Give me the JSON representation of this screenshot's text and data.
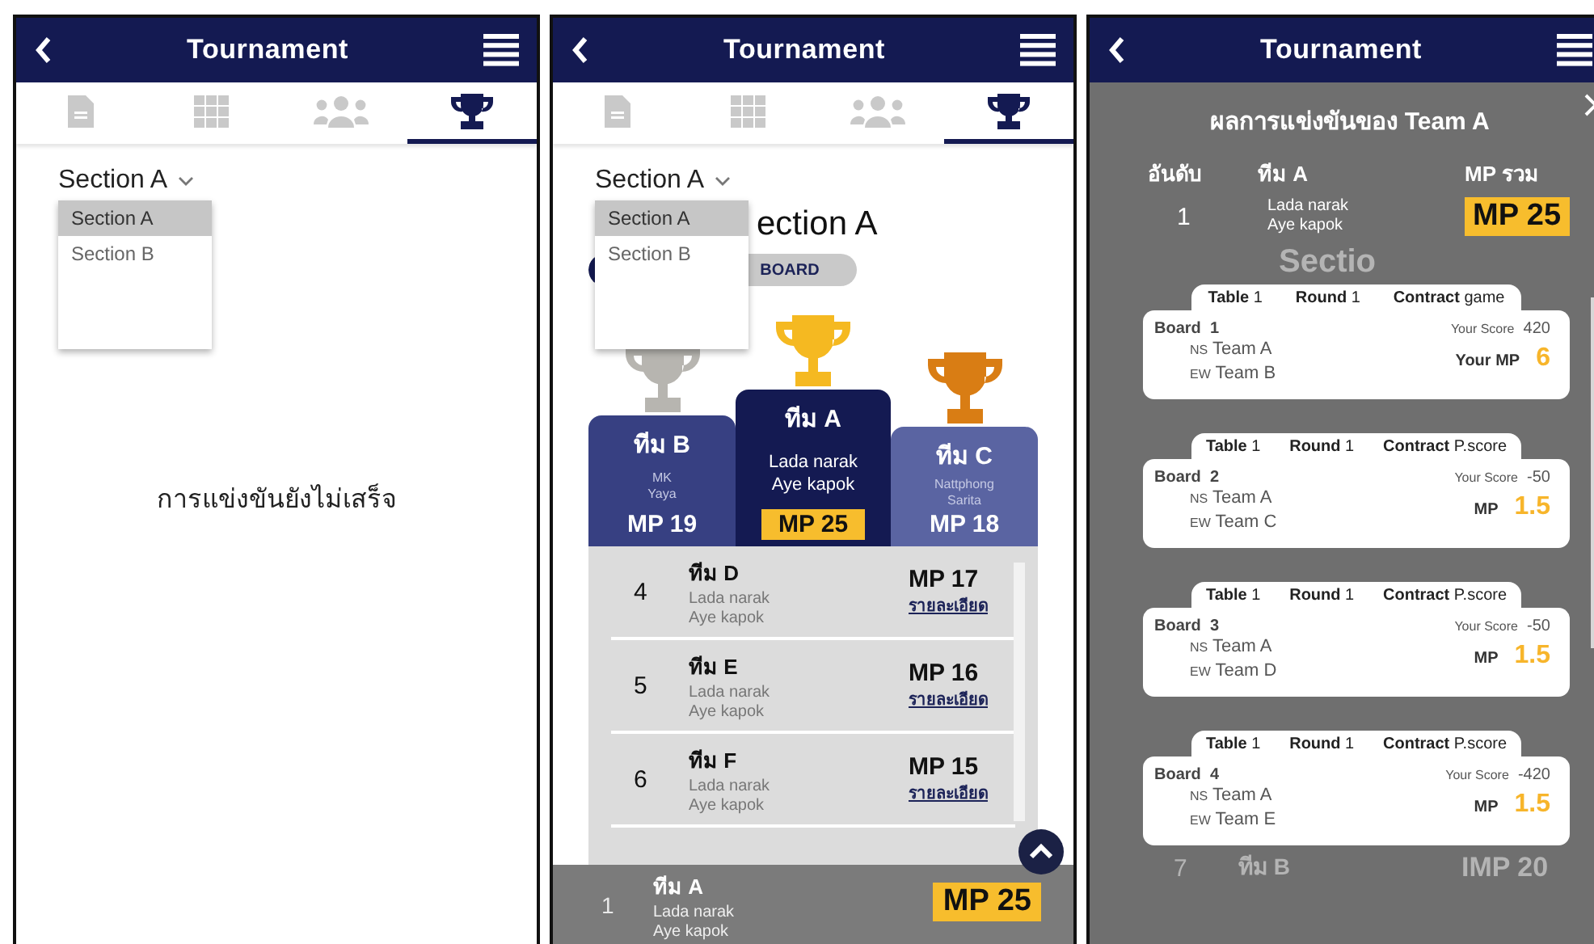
{
  "screens": [
    {
      "header": {
        "title": "Tournament"
      },
      "tabs": [
        {
          "selected": false
        },
        {
          "selected": false
        },
        {
          "selected": false
        },
        {
          "selected": true
        }
      ],
      "section_select": {
        "value": "Section A",
        "options": [
          {
            "label": "Section A",
            "selected": true
          },
          {
            "label": "Section B",
            "selected": false
          }
        ]
      },
      "message": "การแข่งขันยังไม่เสร็จ"
    },
    {
      "header": {
        "title": "Tournament"
      },
      "tabs": [
        {
          "selected": false
        },
        {
          "selected": false
        },
        {
          "selected": false
        },
        {
          "selected": true
        }
      ],
      "section_select": {
        "value": "Section A",
        "options": [
          {
            "label": "Section A",
            "selected": true
          },
          {
            "label": "Section B",
            "selected": false
          }
        ]
      },
      "heading": "ection A",
      "toggle": [
        {
          "selected": true
        },
        {
          "label": "BOARD",
          "selected": false
        }
      ],
      "podium": [
        {
          "kind": "silver",
          "team": "ทีม B",
          "players": [
            "MK",
            "Yaya"
          ],
          "mp": "MP 19"
        },
        {
          "kind": "gold",
          "team": "ทีม A",
          "players": [
            "Lada narak",
            "Aye kapok"
          ],
          "mp": "MP 25"
        },
        {
          "kind": "bronze",
          "team": "ทีม C",
          "players": [
            "Nattphong",
            "Sarita"
          ],
          "mp": "MP 18"
        }
      ],
      "rows": [
        {
          "rank": "4",
          "team": "ทีม D",
          "players": [
            "Lada narak",
            "Aye kapok"
          ],
          "mp": "MP 17",
          "link": "รายละเอียด"
        },
        {
          "rank": "5",
          "team": "ทีม E",
          "players": [
            "Lada narak",
            "Aye kapok"
          ],
          "mp": "MP 16",
          "link": "รายละเอียด"
        },
        {
          "rank": "6",
          "team": "ทีม F",
          "players": [
            "Lada narak",
            "Aye kapok"
          ],
          "mp": "MP 15",
          "link": "รายละเอียด"
        }
      ],
      "my_team": {
        "rank": "1",
        "team": "ทีม A",
        "players": [
          "Lada narak",
          "Aye kapok"
        ],
        "mp": "MP 25"
      }
    },
    {
      "header": {
        "title": "Tournament"
      },
      "background": {
        "heading": "Sectio",
        "rows": [
          {
            "rank": "7",
            "team": "ทีม B",
            "mp": "IMP 20"
          }
        ]
      },
      "modal": {
        "title": "ผลการแข่งขันของ Team A",
        "columns": [
          "อันดับ",
          "ทีม A",
          "MP รวม"
        ],
        "rank": "1",
        "players": [
          "Lada narak",
          "Aye kapok"
        ],
        "mp": "MP 25",
        "boards": [
          {
            "table_label": "Table",
            "table": "1",
            "round_label": "Round",
            "round": "1",
            "contract_label": "Contract",
            "contract": "game",
            "board_label": "Board",
            "board": "1",
            "ns_label": "NS",
            "ns": "Team A",
            "ew_label": "EW",
            "ew": "Team B",
            "score_label": "Your Score",
            "score": "420",
            "mp_label": "Your MP",
            "mp": "6"
          },
          {
            "table_label": "Table",
            "table": "1",
            "round_label": "Round",
            "round": "1",
            "contract_label": "Contract",
            "contract": "P.score",
            "board_label": "Board",
            "board": "2",
            "ns_label": "NS",
            "ns": "Team A",
            "ew_label": "EW",
            "ew": "Team C",
            "score_label": "Your Score",
            "score": "-50",
            "mp_label": "MP",
            "mp": "1.5"
          },
          {
            "table_label": "Table",
            "table": "1",
            "round_label": "Round",
            "round": "1",
            "contract_label": "Contract",
            "contract": "P.score",
            "board_label": "Board",
            "board": "3",
            "ns_label": "NS",
            "ns": "Team A",
            "ew_label": "EW",
            "ew": "Team D",
            "score_label": "Your Score",
            "score": "-50",
            "mp_label": "MP",
            "mp": "1.5"
          },
          {
            "table_label": "Table",
            "table": "1",
            "round_label": "Round",
            "round": "1",
            "contract_label": "Contract",
            "contract": "P.score",
            "board_label": "Board",
            "board": "4",
            "ns_label": "NS",
            "ns": "Team A",
            "ew_label": "EW",
            "ew": "Team E",
            "score_label": "Your Score",
            "score": "-420",
            "mp_label": "MP",
            "mp": "1.5"
          }
        ]
      }
    }
  ]
}
